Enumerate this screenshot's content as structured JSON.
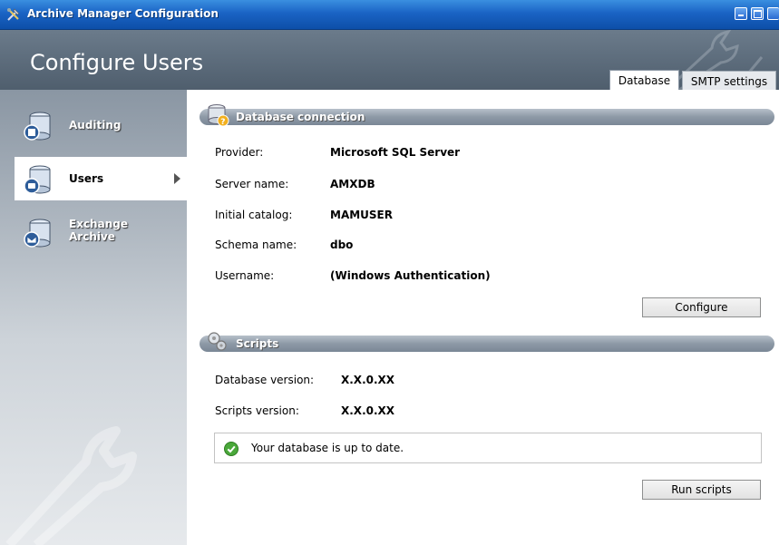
{
  "window": {
    "title": "Archive Manager Configuration"
  },
  "header": {
    "heading": "Configure Users"
  },
  "tabs": [
    {
      "label": "Database",
      "active": true
    },
    {
      "label": "SMTP settings",
      "active": false
    }
  ],
  "sidebar": {
    "items": [
      {
        "label": "Auditing",
        "icon": "auditing-icon",
        "selected": false
      },
      {
        "label": "Users",
        "icon": "users-icon",
        "selected": true
      },
      {
        "label": "Exchange Archive",
        "label_line1": "Exchange",
        "label_line2": "Archive",
        "icon": "exchange-archive-icon",
        "selected": false
      }
    ]
  },
  "database_connection": {
    "title": "Database connection",
    "rows": [
      {
        "label": "Provider:",
        "value": "Microsoft SQL Server"
      },
      {
        "label": "Server name:",
        "value": "AMXDB"
      },
      {
        "label": "Initial catalog:",
        "value": "MAMUSER"
      },
      {
        "label": "Schema name:",
        "value": "dbo"
      },
      {
        "label": "Username:",
        "value": "(Windows Authentication)"
      }
    ],
    "configure_label": "Configure"
  },
  "scripts": {
    "title": "Scripts",
    "rows": [
      {
        "label": "Database version:",
        "value": "X.X.0.XX"
      },
      {
        "label": "Scripts version:",
        "value": "X.X.0.XX"
      }
    ],
    "status_text": "Your database is up to date.",
    "run_label": "Run scripts"
  },
  "colors": {
    "titlebar": "#1a63c4",
    "header": "#5a6a7a",
    "section_bar": "#8d99a6",
    "status_ok": "#3a9a2a"
  }
}
